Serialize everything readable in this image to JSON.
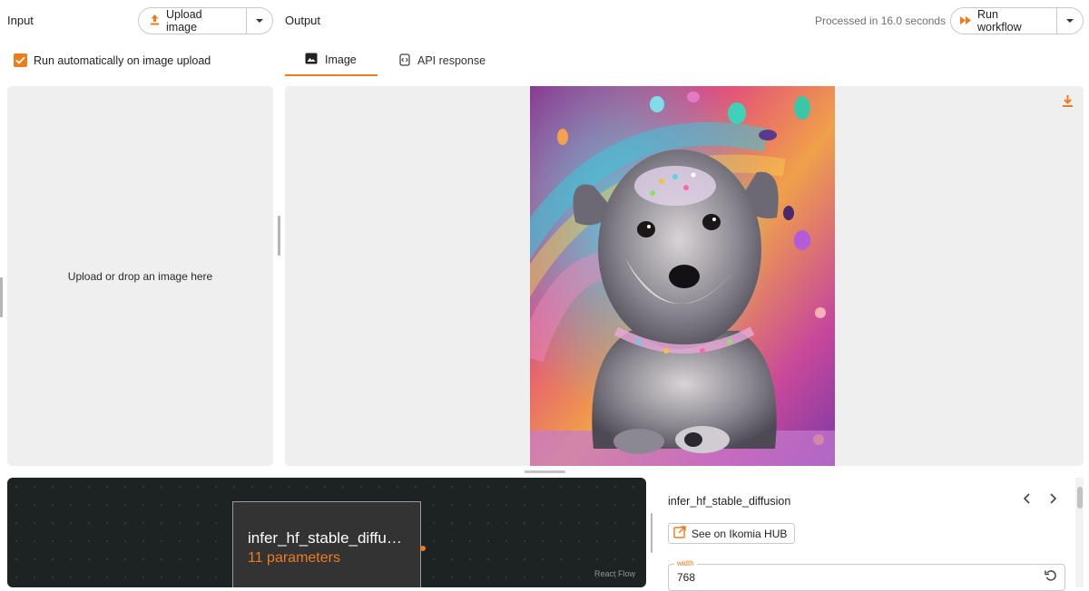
{
  "input": {
    "label": "Input",
    "upload_button": "Upload image",
    "auto_run_label": "Run automatically on image upload",
    "auto_run_checked": true,
    "drop_zone_text": "Upload or drop an image here"
  },
  "output": {
    "label": "Output",
    "processed_text": "Processed in 16.0 seconds",
    "run_button": "Run workflow",
    "tabs": [
      {
        "label": "Image",
        "icon": "image-icon",
        "active": true
      },
      {
        "label": "API response",
        "icon": "api-icon",
        "active": false
      }
    ],
    "download_icon": "download-icon"
  },
  "flow": {
    "node_title": "infer_hf_stable_diffusion",
    "node_subtitle": "11 parameters",
    "attribution": "React Flow"
  },
  "params": {
    "title": "infer_hf_stable_diffusion",
    "hub_button": "See on Ikomia HUB",
    "fields": [
      {
        "label": "width",
        "value": "768"
      }
    ]
  },
  "colors": {
    "accent": "#ee7c1b",
    "panel_bg": "#efefef",
    "flow_bg": "#1d2222"
  }
}
